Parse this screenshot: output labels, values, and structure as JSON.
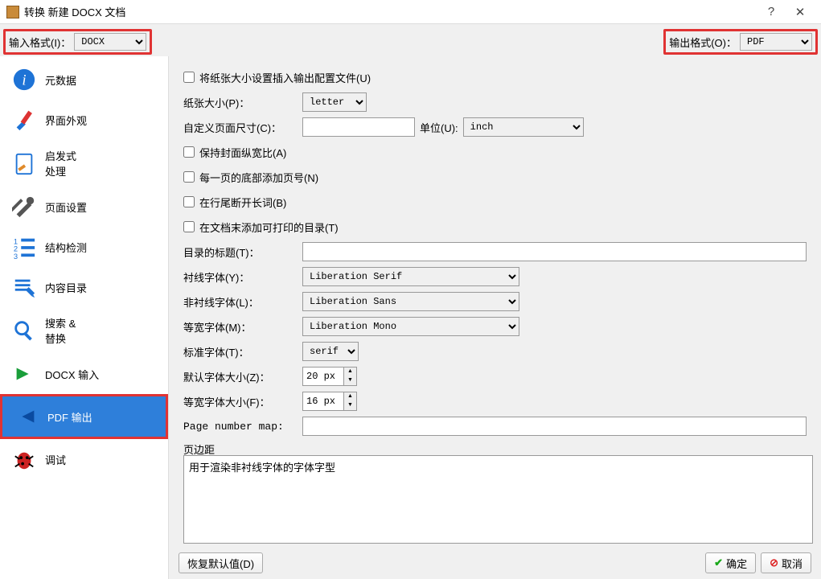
{
  "title": "转换 新建 DOCX 文档",
  "input_format": {
    "label": "输入格式(I)：",
    "value": "DOCX"
  },
  "output_format": {
    "label": "输出格式(O)：",
    "value": "PDF"
  },
  "sidebar": [
    {
      "label": "元数据"
    },
    {
      "label": "界面外观"
    },
    {
      "label": "启发式\n处理"
    },
    {
      "label": "页面设置"
    },
    {
      "label": "结构检测"
    },
    {
      "label": "内容目录"
    },
    {
      "label": "搜索 &\n替换"
    },
    {
      "label": "DOCX 输入"
    },
    {
      "label": "PDF 输出"
    },
    {
      "label": "调试"
    }
  ],
  "form": {
    "insert_pagesize": "将纸张大小设置插入输出配置文件(U)",
    "paper_size_label": "纸张大小(P)：",
    "paper_size_value": "letter",
    "custom_size_label": "自定义页面尺寸(C)：",
    "custom_size_value": "",
    "unit_label": "单位(U):",
    "unit_value": "inch",
    "preserve_cover": "保持封面纵宽比(A)",
    "page_numbers": "每一页的底部添加页号(N)",
    "break_words": "在行尾断开长词(B)",
    "add_toc": "在文档末添加可打印的目录(T)",
    "toc_title_label": "目录的标题(T)：",
    "toc_title_value": "",
    "serif_label": "衬线字体(Y)：",
    "serif_value": "Liberation Serif",
    "sans_label": "非衬线字体(L)：",
    "sans_value": "Liberation Sans",
    "mono_label": "等宽字体(M)：",
    "mono_value": "Liberation Mono",
    "std_font_label": "标准字体(T)：",
    "std_font_value": "serif",
    "def_size_label": "默认字体大小(Z)：",
    "def_size_value": "20 px",
    "mono_size_label": "等宽字体大小(F)：",
    "mono_size_value": "16 px",
    "pnm_label": "Page number map:",
    "pnm_value": "",
    "margins_label": "页边距"
  },
  "help_text": "用于渲染非衬线字体的字体字型",
  "buttons": {
    "restore": "恢复默认值(D)",
    "ok": "确定",
    "cancel": "取消"
  }
}
